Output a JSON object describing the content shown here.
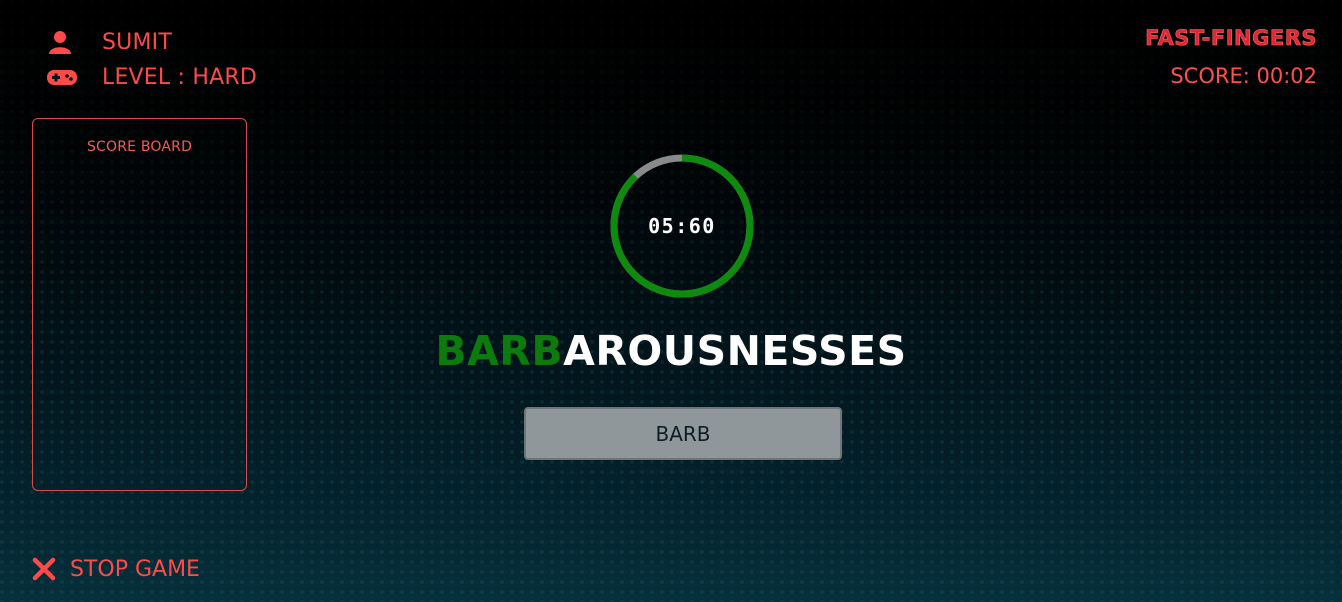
{
  "colors": {
    "accent": "#ff4a4a",
    "typed_letters": "#0d7a0d",
    "timer_ring": "#0e8a0e",
    "timer_track": "#8a8a8a"
  },
  "player": {
    "name": "SUMIT",
    "level_label": "LEVEL : HARD",
    "icons": [
      "user-icon",
      "gamepad-icon"
    ]
  },
  "header": {
    "brand": "FAST-FINGERS",
    "score": "SCORE: 00:02"
  },
  "scoreboard": {
    "title": "SCORE BOARD",
    "entries": []
  },
  "timer": {
    "display": "05:60",
    "remaining_fraction": 0.88
  },
  "word": {
    "typed": "BARB",
    "remaining": "AROUSNESSES"
  },
  "input": {
    "value": "BARB"
  },
  "controls": {
    "stop_label": "STOP GAME",
    "stop_icon": "close-icon"
  }
}
